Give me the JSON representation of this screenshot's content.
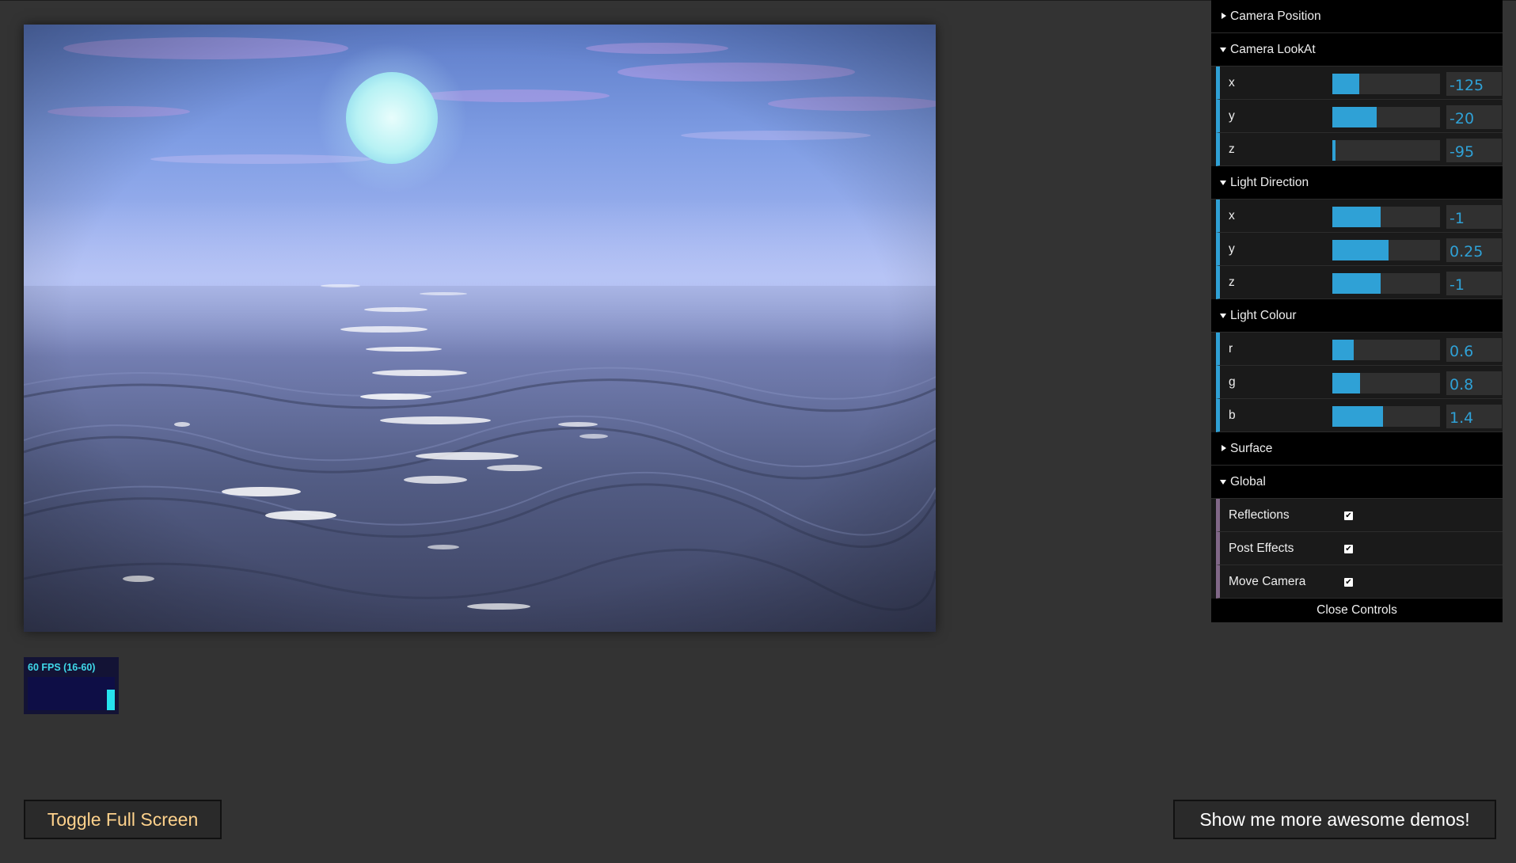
{
  "fps": {
    "label": "60 FPS (16-60)",
    "bar_level": 0.62
  },
  "panel": {
    "folders": {
      "camera_position": {
        "title": "Camera Position",
        "open": false
      },
      "camera_lookat": {
        "title": "Camera LookAt",
        "open": true,
        "controls": [
          {
            "label": "x",
            "value": "-125",
            "fill": 0.25
          },
          {
            "label": "y",
            "value": "-20",
            "fill": 0.41
          },
          {
            "label": "z",
            "value": "-95",
            "fill": 0.03
          }
        ]
      },
      "light_direction": {
        "title": "Light Direction",
        "open": true,
        "controls": [
          {
            "label": "x",
            "value": "-1",
            "fill": 0.45
          },
          {
            "label": "y",
            "value": "0.25",
            "fill": 0.52
          },
          {
            "label": "z",
            "value": "-1",
            "fill": 0.45
          }
        ]
      },
      "light_colour": {
        "title": "Light Colour",
        "open": true,
        "controls": [
          {
            "label": "r",
            "value": "0.6",
            "fill": 0.2
          },
          {
            "label": "g",
            "value": "0.8",
            "fill": 0.26
          },
          {
            "label": "b",
            "value": "1.4",
            "fill": 0.47
          }
        ]
      },
      "surface": {
        "title": "Surface",
        "open": false
      },
      "global": {
        "title": "Global",
        "open": true,
        "toggles": [
          {
            "label": "Reflections",
            "checked": true
          },
          {
            "label": "Post Effects",
            "checked": true
          },
          {
            "label": "Move Camera",
            "checked": true
          }
        ]
      }
    },
    "close_label": "Close Controls",
    "check_glyph": "✔"
  },
  "buttons": {
    "fullscreen_label": "Toggle Full Screen",
    "demos_label": "Show me more awesome demos!"
  },
  "colors": {
    "background": "#333333",
    "accent_number": "#2fa1d6",
    "accent_boolean": "#806787",
    "fps_text": "#3fd9ea",
    "fullscreen_text": "#ffd28c"
  }
}
